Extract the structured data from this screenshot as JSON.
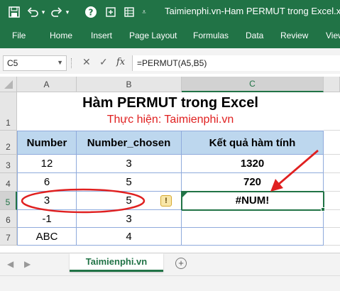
{
  "window": {
    "title": "Taimienphi.vn-Ham PERMUT trong Excel.xls",
    "brand_color": "#217346"
  },
  "qat": {
    "icons": [
      "save-icon",
      "undo-icon",
      "redo-icon",
      "help-icon",
      "new-sheet-icon",
      "customize-icon"
    ]
  },
  "ribbon": {
    "tabs": [
      "File",
      "Home",
      "Insert",
      "Page Layout",
      "Formulas",
      "Data",
      "Review",
      "View"
    ]
  },
  "formula_bar": {
    "name_box": "C5",
    "fx_label": "fx",
    "formula": "=PERMUT(A5,B5)"
  },
  "sheet": {
    "columns": [
      "A",
      "B",
      "C"
    ],
    "rows": [
      "1",
      "2",
      "3",
      "4",
      "5",
      "6",
      "7"
    ],
    "title": "Hàm PERMUT trong Excel",
    "subtitle": "Thực hiện: Taimienphi.vn",
    "headers": [
      "Number",
      "Number_chosen",
      "Kết quả hàm tính"
    ],
    "data": [
      [
        "12",
        "3",
        "1320"
      ],
      [
        "6",
        "5",
        "720"
      ],
      [
        "3",
        "5",
        "#NUM!"
      ],
      [
        "-1",
        "3",
        ""
      ],
      [
        "ABC",
        "4",
        ""
      ]
    ],
    "selected_cell": "C5",
    "warning_glyph": "!",
    "header_fill": "#bdd7ee",
    "subtitle_color": "#e02020",
    "annotation_color": "#e02020"
  },
  "tabs": {
    "sheet_name": "Taimienphi.vn",
    "prev": "◀",
    "next": "▶",
    "add": "+"
  }
}
